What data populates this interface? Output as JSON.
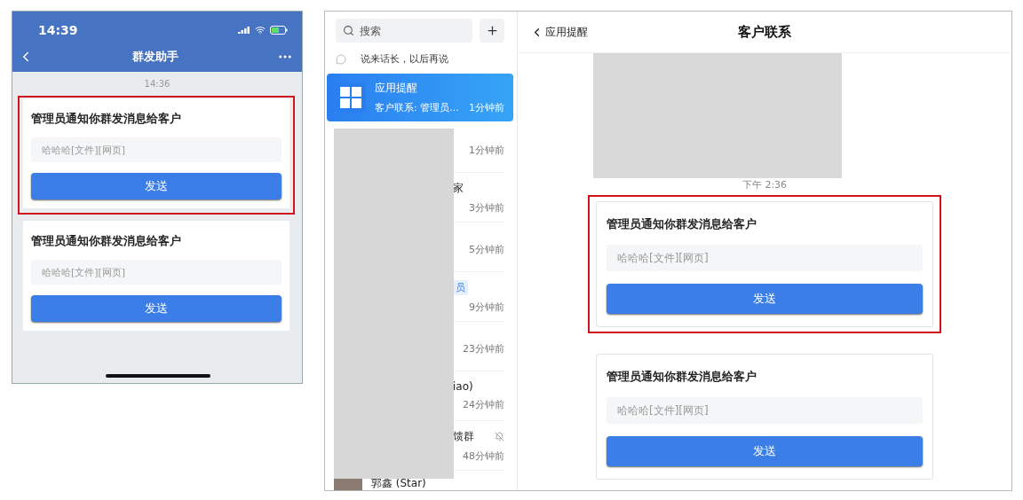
{
  "phone": {
    "status_time": "14:39",
    "title": "群发助手",
    "timestamp": "14:36",
    "cards": [
      {
        "title": "管理员通知你群发消息给客户",
        "placeholder": "哈哈哈[文件][网页]",
        "button": "发送",
        "highlighted": true
      },
      {
        "title": "管理员通知你群发消息给客户",
        "placeholder": "哈哈哈[文件][网页]",
        "button": "发送",
        "highlighted": false
      }
    ]
  },
  "desktop": {
    "search": {
      "placeholder": "搜索"
    },
    "status_note": "说来话长，以后再说",
    "conversations": [
      {
        "kind": "app",
        "name": "应用提醒",
        "preview": "客户联系: 管理员...",
        "time": "1分钟前",
        "selected": true
      },
      {
        "kind": "redacted",
        "time": "1分钟前",
        "muted": false,
        "selected": false
      },
      {
        "kind": "redacted",
        "name_fragment": "家",
        "time": "3分钟前",
        "muted": false,
        "selected": false
      },
      {
        "kind": "redacted",
        "time": "5分钟前",
        "muted": false,
        "selected": false
      },
      {
        "kind": "redacted",
        "badge_fragment": "员",
        "time": "9分钟前",
        "muted": false,
        "selected": false
      },
      {
        "kind": "redacted",
        "time": "23分钟前",
        "muted": false,
        "selected": false
      },
      {
        "kind": "redacted",
        "name_fragment": "iao)",
        "time": "24分钟前",
        "muted": false,
        "selected": false
      },
      {
        "kind": "redacted",
        "name_fragment": "馈群",
        "time": "48分钟前",
        "muted": true,
        "selected": false
      },
      {
        "kind": "contact",
        "name": "郭鑫 (Star)",
        "selected": false
      }
    ],
    "chat": {
      "back": "应用提醒",
      "title": "客户联系",
      "timestamp": "下午 2:36",
      "cards": [
        {
          "title": "管理员通知你群发消息给客户",
          "placeholder": "哈哈哈[文件][网页]",
          "button": "发送",
          "highlighted": true
        },
        {
          "title": "管理员通知你群发消息给客户",
          "placeholder": "哈哈哈[文件][网页]",
          "button": "发送",
          "highlighted": false
        }
      ]
    }
  }
}
